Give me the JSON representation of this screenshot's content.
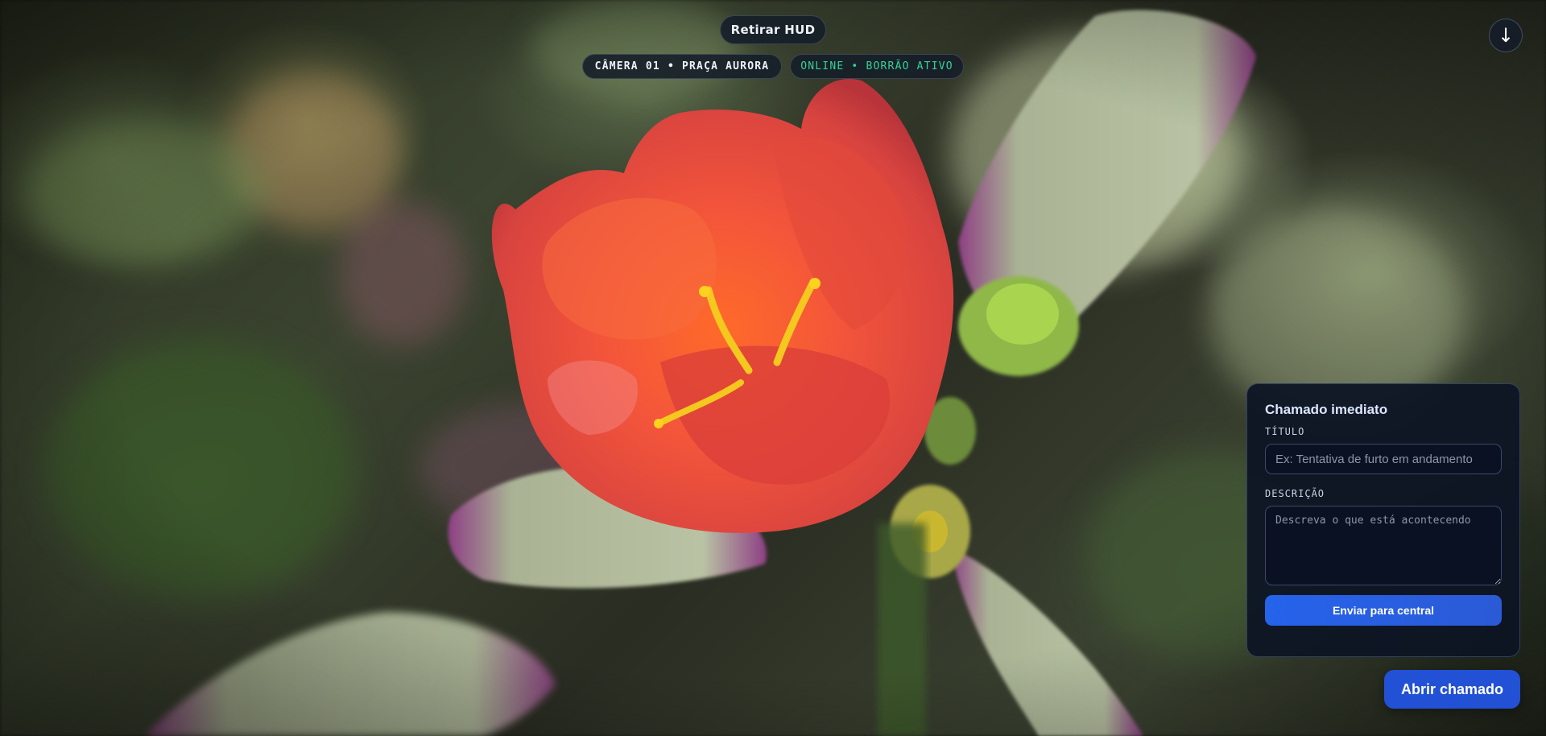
{
  "hud": {
    "toggle_label": "Retirar HUD",
    "camera_label": "CÂMERA 01 • PRAÇA AURORA",
    "status_label": "ONLINE • BORRÃO ATIVO",
    "status_color": "#34d399",
    "download_icon": "arrow-down-icon",
    "download_glyph": "↓"
  },
  "panel": {
    "title": "Chamado imediato",
    "title_field": {
      "label": "TÍTULO",
      "value": "",
      "placeholder": "Ex: Tentativa de furto em andamento"
    },
    "description_field": {
      "label": "DESCRIÇÃO",
      "value": "",
      "placeholder": "Descreva o que está acontecendo"
    },
    "submit_label": "Enviar para central"
  },
  "open_ticket_label": "Abrir chamado",
  "colors": {
    "accent": "#2563eb",
    "panel_bg": "#0d1424"
  }
}
